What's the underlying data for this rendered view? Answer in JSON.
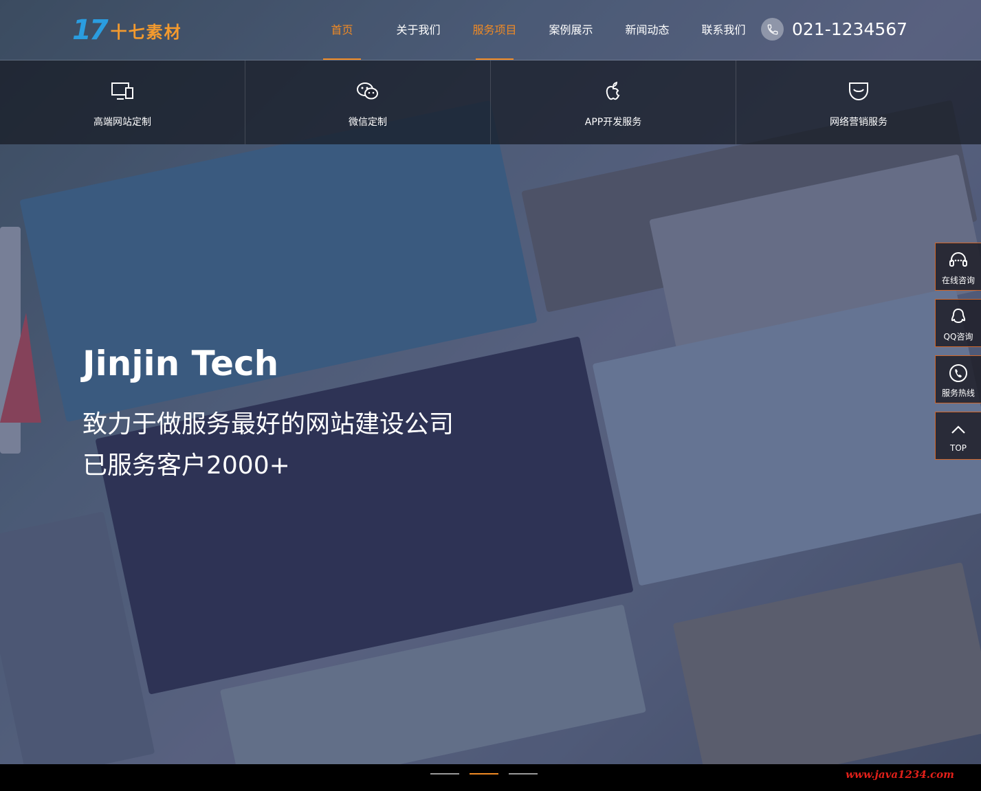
{
  "logo": {
    "mark": "17",
    "text": "十七素材"
  },
  "nav": {
    "items": [
      {
        "label": "首页",
        "active": true
      },
      {
        "label": "关于我们",
        "active": false
      },
      {
        "label": "服务项目",
        "active": true
      },
      {
        "label": "案例展示",
        "active": false
      },
      {
        "label": "新闻动态",
        "active": false
      },
      {
        "label": "联系我们",
        "active": false
      }
    ]
  },
  "phone": {
    "icon": "phone-icon",
    "number": "021-1234567"
  },
  "services": [
    {
      "icon": "monitor-icon",
      "label": "高端网站定制"
    },
    {
      "icon": "wechat-icon",
      "label": "微信定制"
    },
    {
      "icon": "apple-icon",
      "label": "APP开发服务"
    },
    {
      "icon": "shopping-bag-icon",
      "label": "网络营销服务"
    }
  ],
  "hero": {
    "headline": "Jinjin Tech",
    "line1": "致力于做服务最好的网站建设公司",
    "line2": "已服务客户2000+"
  },
  "side_tools": [
    {
      "icon": "headset-icon",
      "label": "在线咨询"
    },
    {
      "icon": "qq-icon",
      "label": "QQ咨询"
    },
    {
      "icon": "phone-icon",
      "label": "服务热线"
    },
    {
      "icon": "chevron-up-icon",
      "label": "TOP"
    }
  ],
  "slider": {
    "count": 3,
    "active_index": 1
  },
  "watermark": "www.java1234.com",
  "colors": {
    "accent": "#f08a24",
    "logo_blue": "#2a9de0",
    "logo_orange": "#f39a2e",
    "watermark": "#e0201a"
  }
}
